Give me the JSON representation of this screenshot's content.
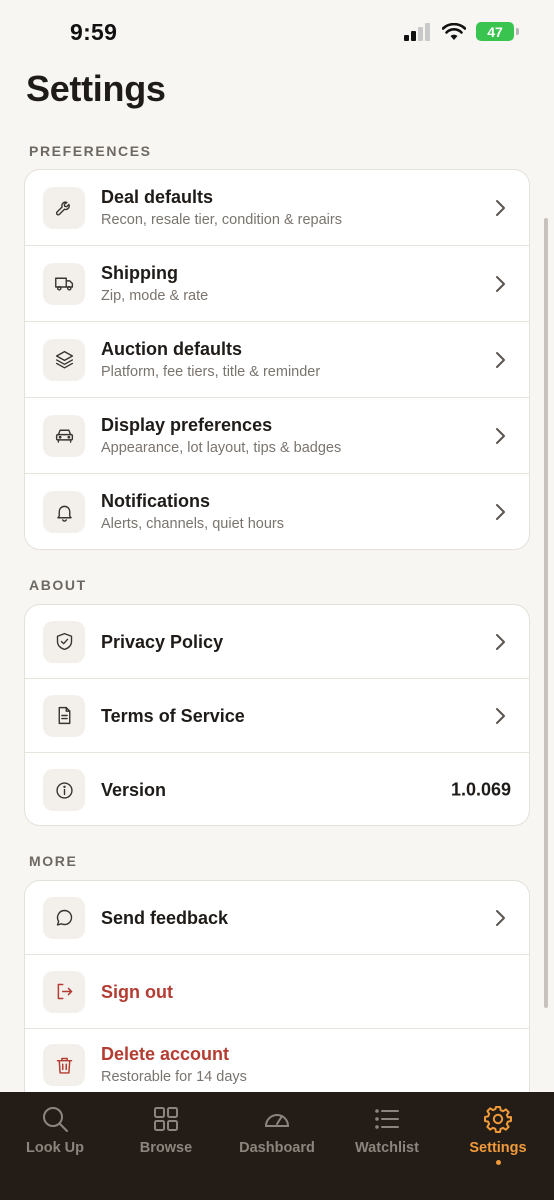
{
  "status_bar": {
    "time": "9:59",
    "battery": "47"
  },
  "page": {
    "title": "Settings"
  },
  "sections": {
    "preferences": {
      "header": "PREFERENCES",
      "items": [
        {
          "title": "Deal defaults",
          "subtitle": "Recon, resale tier, condition & repairs",
          "icon": "wrench-icon"
        },
        {
          "title": "Shipping",
          "subtitle": "Zip, mode & rate",
          "icon": "truck-icon"
        },
        {
          "title": "Auction defaults",
          "subtitle": "Platform, fee tiers, title & reminder",
          "icon": "layers-icon"
        },
        {
          "title": "Display preferences",
          "subtitle": "Appearance, lot layout, tips & badges",
          "icon": "car-icon"
        },
        {
          "title": "Notifications",
          "subtitle": "Alerts, channels, quiet hours",
          "icon": "bell-icon"
        }
      ]
    },
    "about": {
      "header": "ABOUT",
      "items": [
        {
          "title": "Privacy Policy",
          "icon": "shield-check-icon"
        },
        {
          "title": "Terms of Service",
          "icon": "document-icon"
        },
        {
          "title": "Version",
          "value": "1.0.069",
          "icon": "info-icon"
        }
      ]
    },
    "more": {
      "header": "MORE",
      "items": [
        {
          "title": "Send feedback",
          "icon": "chat-bubble-icon"
        },
        {
          "title": "Sign out",
          "icon": "sign-out-icon"
        },
        {
          "title": "Delete account",
          "subtitle": "Restorable for 14 days",
          "icon": "trash-icon"
        }
      ]
    }
  },
  "tabbar": {
    "tabs": [
      {
        "label": "Look Up",
        "icon": "search-icon"
      },
      {
        "label": "Browse",
        "icon": "grid-icon"
      },
      {
        "label": "Dashboard",
        "icon": "gauge-icon"
      },
      {
        "label": "Watchlist",
        "icon": "list-icon"
      },
      {
        "label": "Settings",
        "icon": "gear-icon",
        "active": true
      }
    ]
  },
  "colors": {
    "accent": "#f09a3a",
    "danger": "#b43c32",
    "tabbar_bg": "#241d17",
    "background": "#f8f6f2"
  }
}
